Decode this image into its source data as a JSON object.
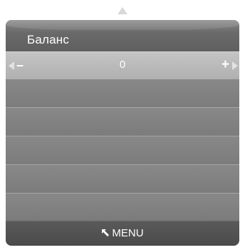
{
  "menu": {
    "title": "Баланс",
    "value": "0",
    "decrease_label": "–",
    "increase_label": "+",
    "footer_label": "MENU"
  },
  "icons": {
    "scroll_up": "triangle-up-icon",
    "left": "triangle-left-icon",
    "right": "triangle-right-icon",
    "return": "return-arrow-icon"
  },
  "colors": {
    "panel": "#7a7a7a",
    "selected_row": "#b8b8b8",
    "footer": "#505050",
    "text": "#ffffff"
  }
}
